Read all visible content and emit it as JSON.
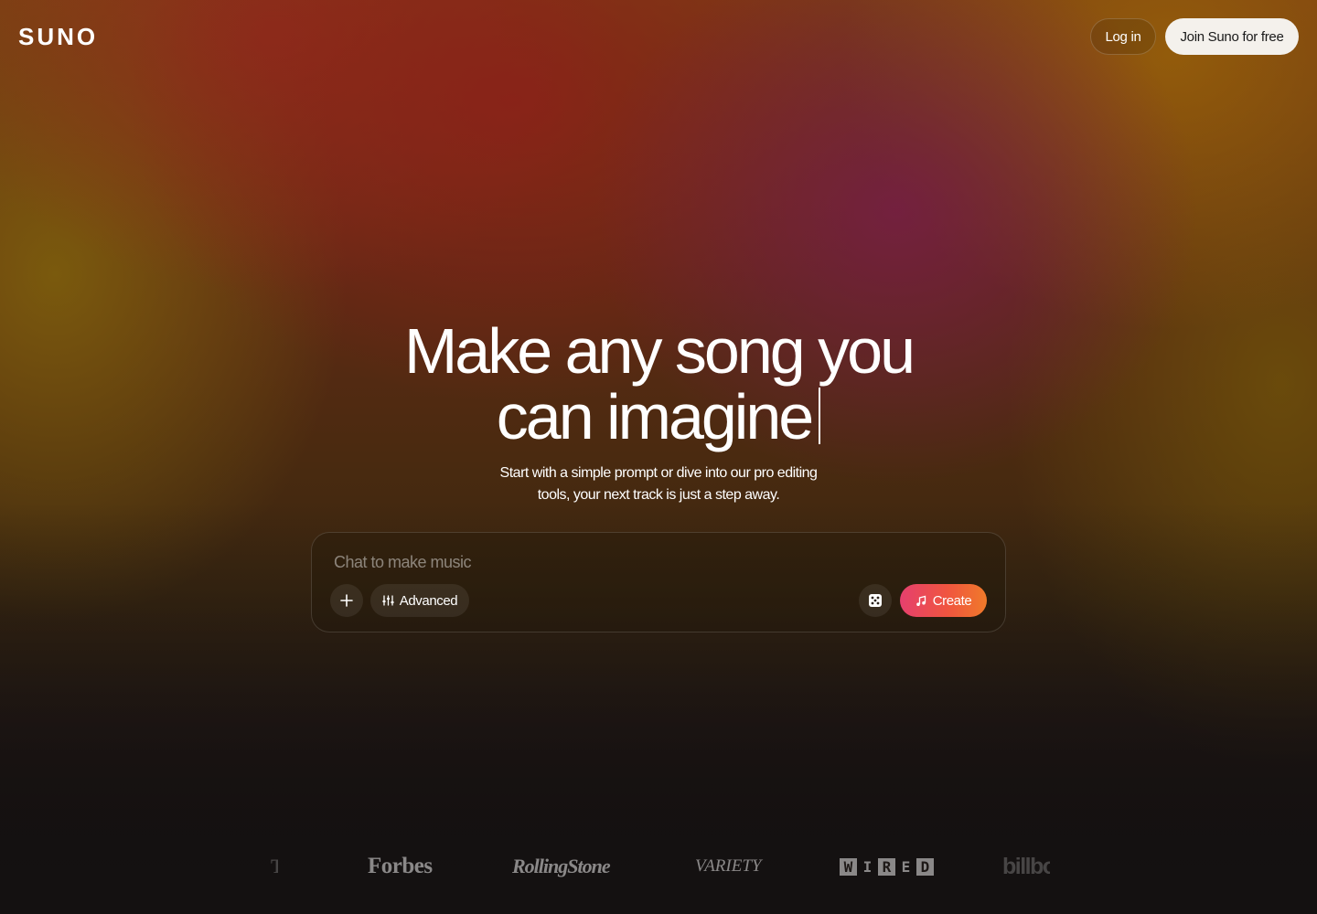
{
  "nav": {
    "logo": "SUNO",
    "login_label": "Log in",
    "join_label": "Join Suno for free"
  },
  "hero": {
    "headline_line1": "Make any song you",
    "headline_line2": "can imagine",
    "subtitle": "Start with a simple prompt or dive into our pro editing tools, your next track is just a step away."
  },
  "composer": {
    "placeholder": "Chat to make music",
    "value": "",
    "add_icon": "plus-icon",
    "advanced_label": "Advanced",
    "advanced_icon": "sliders-icon",
    "random_icon": "dice-icon",
    "create_label": "Create",
    "create_icon": "music-note-icon",
    "create_gradient": [
      "#e5406e",
      "#f07a2a"
    ]
  },
  "press": {
    "items": [
      "Forbes",
      "RollingStone",
      "VARIETY",
      "WIRED",
      "billboard"
    ]
  },
  "colors": {
    "join_bg": "#f4f1ec",
    "background_top": "#7a3d14",
    "background_bottom": "#131111"
  }
}
